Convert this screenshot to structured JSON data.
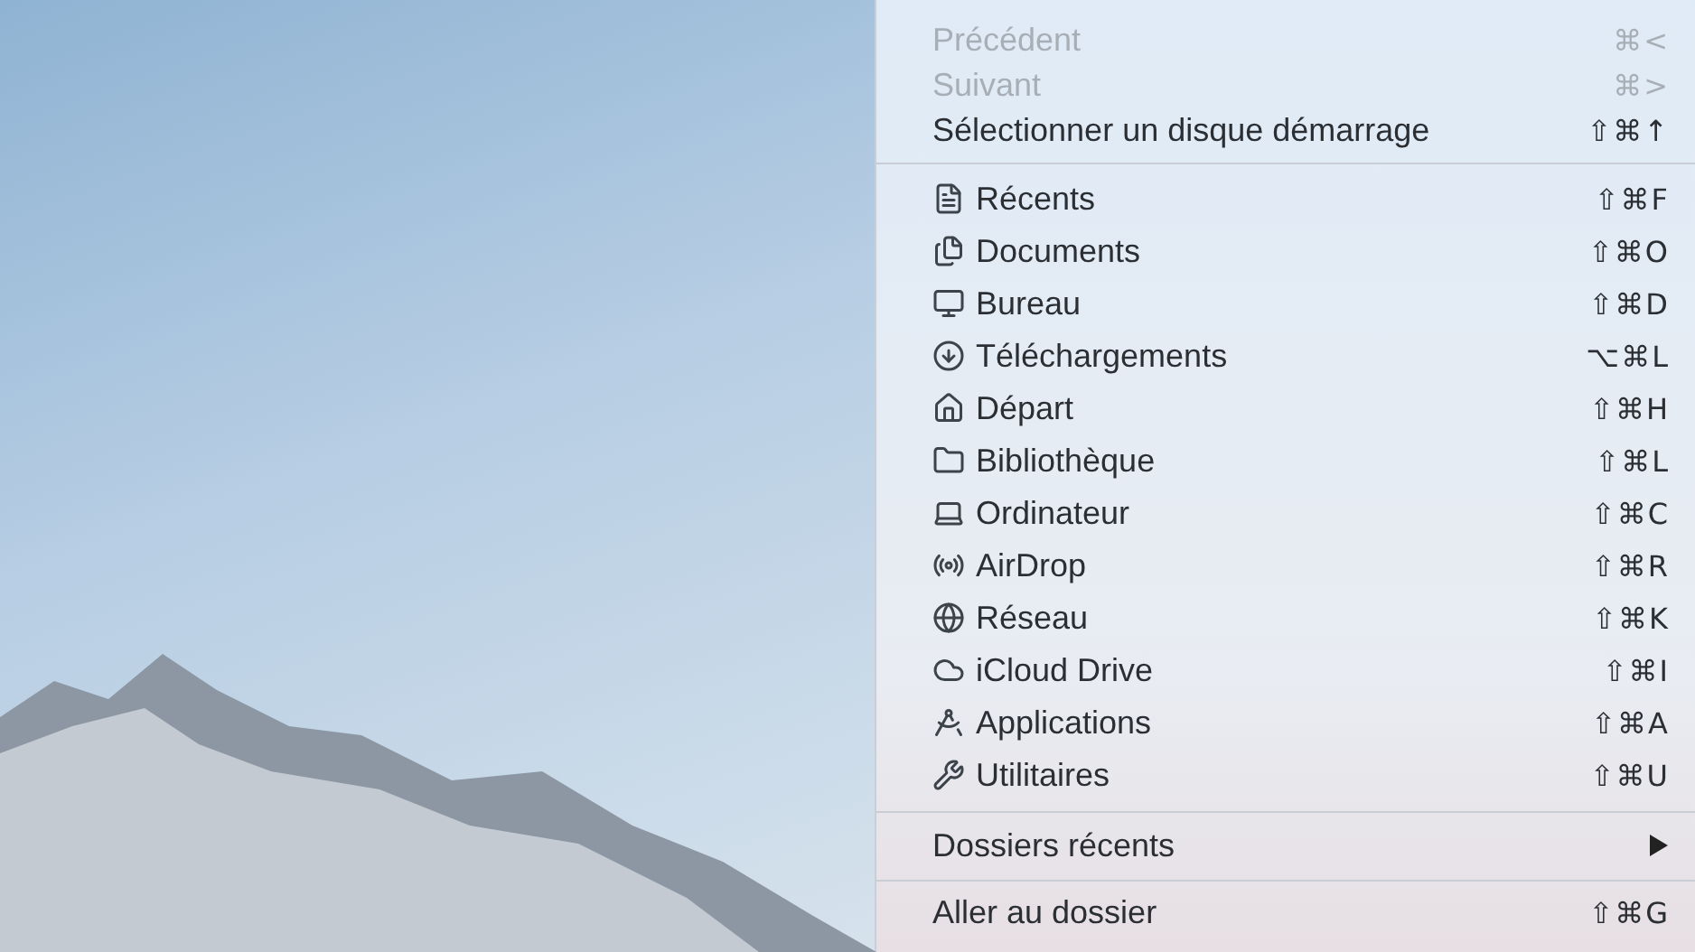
{
  "menu": {
    "groups": [
      {
        "items": [
          {
            "kind": "plain",
            "label": "Précédent",
            "shortcut": "⌘<",
            "disabled": true
          },
          {
            "kind": "plain",
            "label": "Suivant",
            "shortcut": "⌘>",
            "disabled": true
          },
          {
            "kind": "plain",
            "label": "Sélectionner un disque démarrage",
            "shortcut": "⇧⌘↑",
            "disabled": false
          }
        ]
      },
      {
        "items": [
          {
            "kind": "icon",
            "label": "Récents",
            "shortcut": "⇧⌘F",
            "disabled": false
          },
          {
            "kind": "icon",
            "label": "Documents",
            "shortcut": "⇧⌘O",
            "disabled": false
          },
          {
            "kind": "icon",
            "label": "Bureau",
            "shortcut": "⇧⌘D",
            "disabled": false
          },
          {
            "kind": "icon",
            "label": "Téléchargements",
            "shortcut": "⌥⌘L",
            "disabled": false
          },
          {
            "kind": "icon",
            "label": "Départ",
            "shortcut": "⇧⌘H",
            "disabled": false
          },
          {
            "kind": "icon",
            "label": "Bibliothèque",
            "shortcut": "⇧⌘L",
            "disabled": false
          },
          {
            "kind": "icon",
            "label": "Ordinateur",
            "shortcut": "⇧⌘C",
            "disabled": false
          },
          {
            "kind": "icon",
            "label": "AirDrop",
            "shortcut": "⇧⌘R",
            "disabled": false
          },
          {
            "kind": "icon",
            "label": "Réseau",
            "shortcut": "⇧⌘K",
            "disabled": false
          },
          {
            "kind": "icon",
            "label": "iCloud Drive",
            "shortcut": "⇧⌘I",
            "disabled": false
          },
          {
            "kind": "icon",
            "label": "Applications",
            "shortcut": "⇧⌘A",
            "disabled": false
          },
          {
            "kind": "icon",
            "label": "Utilitaires",
            "shortcut": "⇧⌘U",
            "disabled": false
          }
        ]
      },
      {
        "items": [
          {
            "kind": "submenu",
            "label": "Dossiers récents",
            "disabled": false
          }
        ]
      },
      {
        "items": [
          {
            "kind": "plain",
            "label": "Aller au dossier",
            "shortcut": "⇧⌘G",
            "disabled": false
          }
        ]
      }
    ]
  }
}
